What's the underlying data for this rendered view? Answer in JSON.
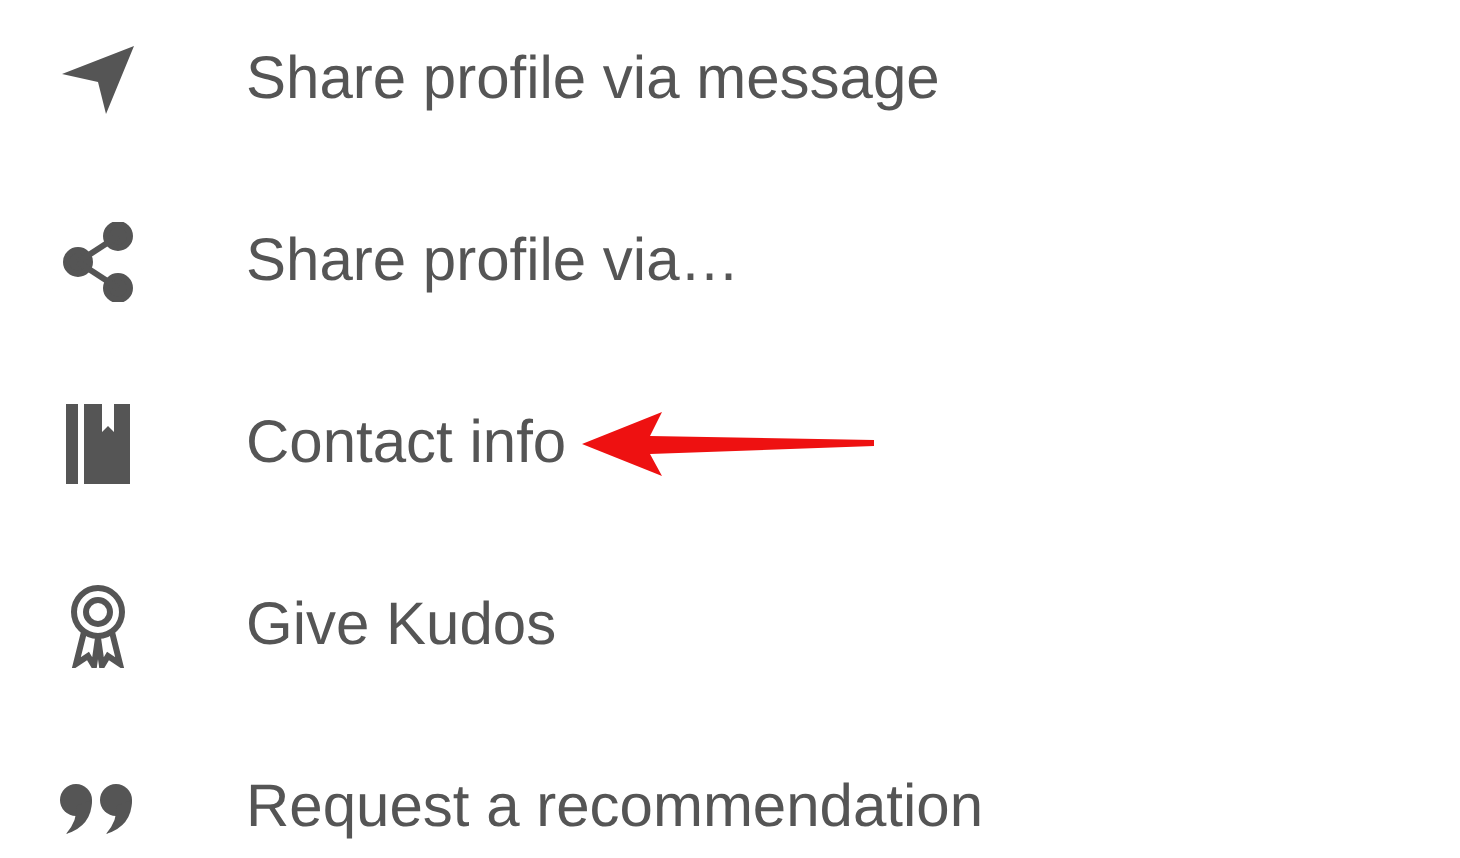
{
  "menu": {
    "items": [
      {
        "kind": "send",
        "label": "Share profile via message",
        "pointed": false
      },
      {
        "kind": "share",
        "label": "Share profile via…",
        "pointed": false
      },
      {
        "kind": "contact",
        "label": "Contact info",
        "pointed": true
      },
      {
        "kind": "award",
        "label": "Give Kudos",
        "pointed": false
      },
      {
        "kind": "quote",
        "label": "Request a recommendation",
        "pointed": false
      }
    ]
  }
}
